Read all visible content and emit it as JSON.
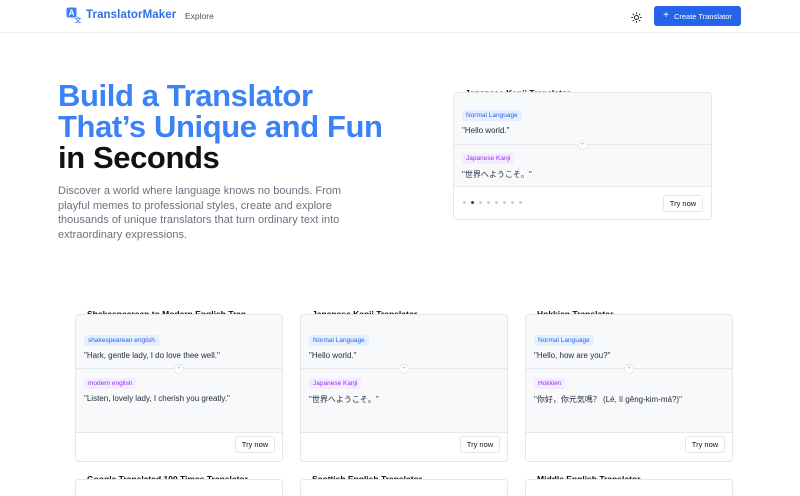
{
  "header": {
    "app_name": "TranslatorMaker",
    "nav_explore": "Explore",
    "create_button": "Create Translator"
  },
  "hero": {
    "title_line1": "Build a Translator",
    "title_line2": "That’s Unique and Fun",
    "title_line3": "in Seconds",
    "description": "Discover a world where language knows no bounds. From playful memes to professional styles, create and explore thousands of unique translators that turn ordinary text into extraordinary expressions."
  },
  "featured": {
    "title": "Japanese Kanji Translator",
    "source_label": "Normal Language",
    "source_text": "\"Hello world.\"",
    "target_label": "Japanese Kanji",
    "target_text": "\"世界へようこそ。\"",
    "try_label": "Try now",
    "slides": 8,
    "active_slide": 2
  },
  "cards": [
    {
      "title": "Shakespearean to Modern English Tran...",
      "source_label": "shakespearean english",
      "source_text": "\"Hark, gentle lady, I do love thee well.\"",
      "target_label": "modern english",
      "target_text": "\"Listen, lovely lady, I cherish you greatly.\"",
      "try_label": "Try now"
    },
    {
      "title": "Japanese Kanji Translator",
      "source_label": "Normal Language",
      "source_text": "\"Hello world.\"",
      "target_label": "Japanese Kanji",
      "target_text": "\"世界へようこそ。\"",
      "try_label": "Try now"
    },
    {
      "title": "Hokkien Translator",
      "source_label": "Normal Language",
      "source_text": "\"Hello, how are you?\"",
      "target_label": "Hokkien",
      "target_text": "\"你好，你元気嗎？ (Lé, lí gêng-kim-má?)\"",
      "try_label": "Try now"
    }
  ],
  "next_row_titles": [
    "Google Translated 100 Times Translator",
    "Scottish English Translator",
    "Middle English Translator"
  ],
  "colors": {
    "brand": "#2563eb",
    "hero_blue": "#3b82f6",
    "badge_blue": "#2563eb",
    "badge_purple": "#9333ea"
  },
  "icons": {
    "logo": "translate-logo-icon",
    "theme": "sun-icon",
    "create": "plus-icon"
  }
}
